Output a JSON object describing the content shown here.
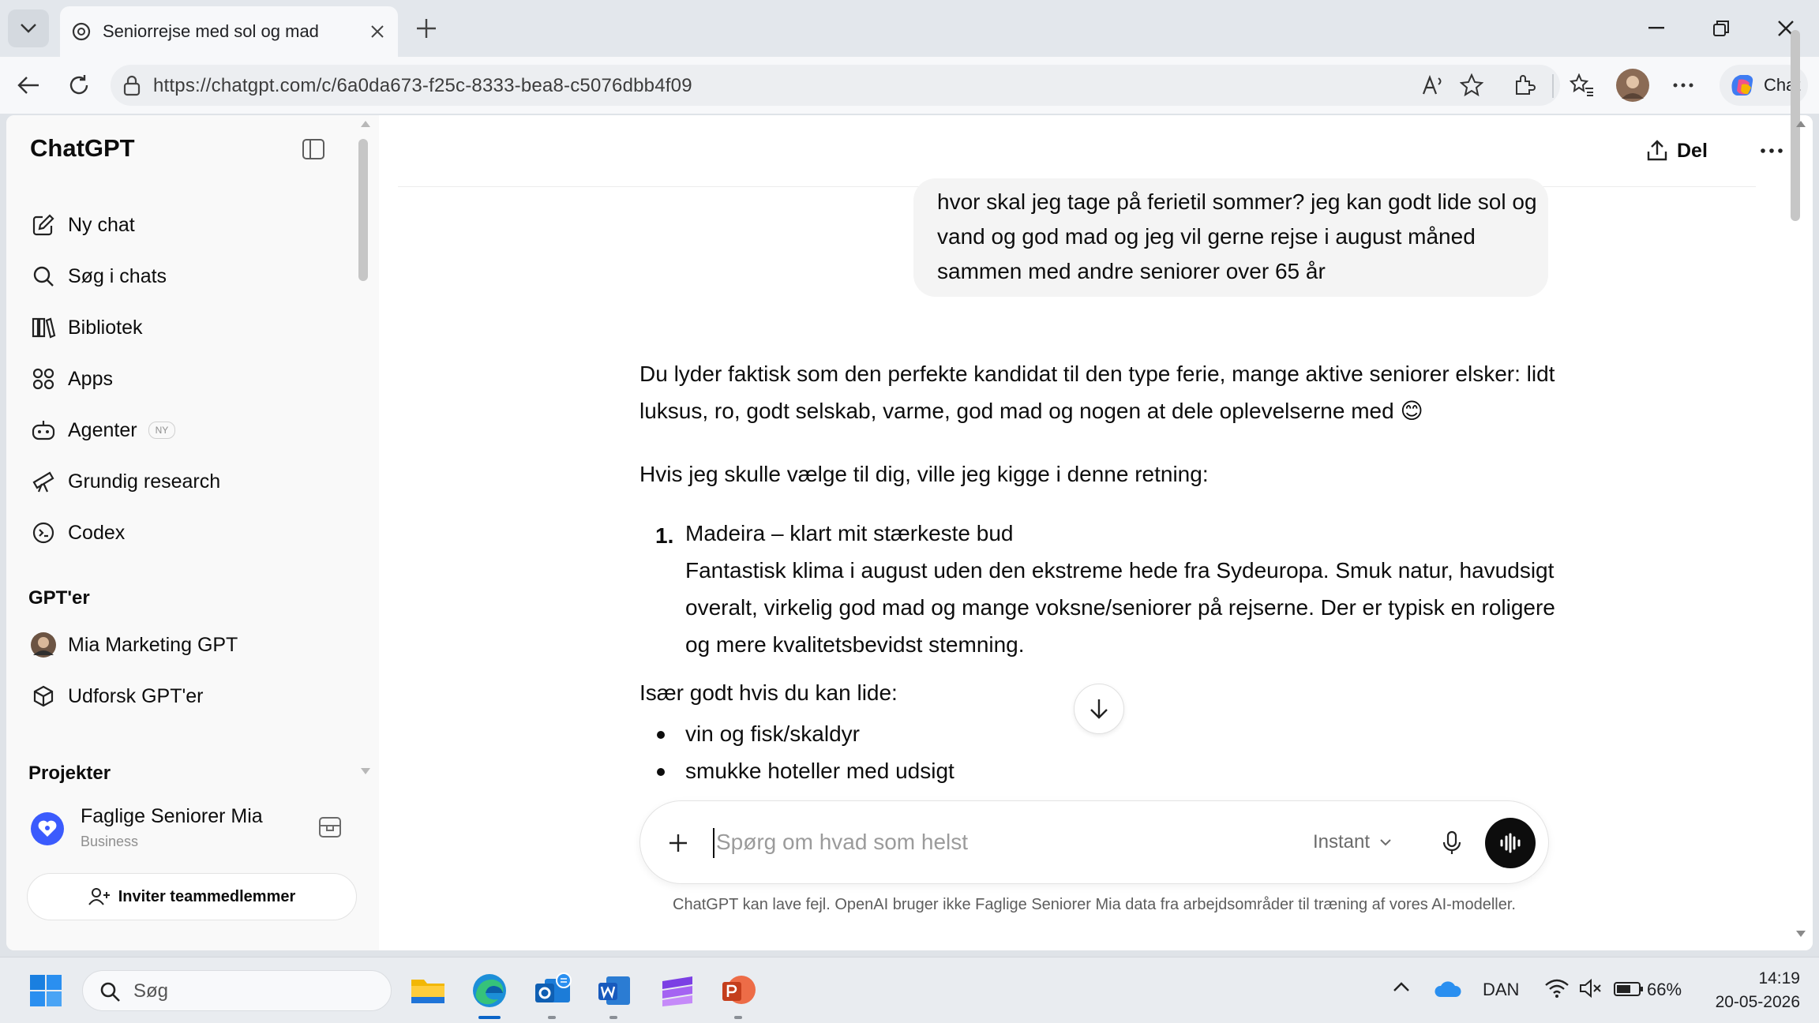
{
  "browser": {
    "tab_title": "Seniorrejse med sol og mad",
    "url": "https://chatgpt.com/c/6a0da673-f25c-8333-bea8-c5076dbb4f09",
    "copilot_label": "Chat"
  },
  "sidebar": {
    "brand": "ChatGPT",
    "nav": [
      {
        "label": "Ny chat",
        "icon": "new-chat-icon"
      },
      {
        "label": "Søg i chats",
        "icon": "search-icon"
      },
      {
        "label": "Bibliotek",
        "icon": "library-icon"
      },
      {
        "label": "Apps",
        "icon": "apps-icon"
      },
      {
        "label": "Agenter",
        "icon": "agent-icon",
        "badge": "NY"
      },
      {
        "label": "Grundig research",
        "icon": "telescope-icon"
      },
      {
        "label": "Codex",
        "icon": "codex-icon"
      }
    ],
    "gpts_heading": "GPT'er",
    "gpts": [
      {
        "label": "Mia Marketing GPT",
        "icon": "gpt-avatar-icon"
      },
      {
        "label": "Udforsk GPT'er",
        "icon": "cube-icon"
      }
    ],
    "projects_heading": "Projekter",
    "project": {
      "name": "Faglige Seniorer Mia",
      "plan": "Business"
    },
    "invite_label": "Inviter teammedlemmer"
  },
  "header": {
    "share_label": "Del"
  },
  "conversation": {
    "user_message": "hvor skal jeg tage på ferietil sommer? jeg kan godt lide sol og vand og god mad og jeg vil gerne rejse i august måned sammen med andre seniorer over 65 år",
    "assistant": {
      "intro": "Du lyder faktisk som den perfekte kandidat til den type ferie, mange aktive seniorer elsker: lidt luksus, ro, godt selskab, varme, god mad og nogen at dele oplevelserne med 😊",
      "lead": "Hvis jeg skulle vælge til dig, ville jeg kigge i denne retning:",
      "item_number": "1.",
      "item_title": "Madeira – klart mit stærkeste bud",
      "item_body": "Fantastisk klima i august uden den ekstreme hede fra Sydeuropa. Smuk natur, havudsigt overalt, virkelig god mad og mange voksne/seniorer på rejserne. Der er typisk en roligere og mere kvalitetsbevidst stemning.",
      "sub_heading": "Især godt hvis du kan lide:",
      "bullets": [
        "vin og fisk/skaldyr",
        "smukke hoteller med udsigt"
      ]
    }
  },
  "composer": {
    "placeholder": "Spørg om hvad som helst",
    "model": "Instant",
    "disclaimer": "ChatGPT kan lave fejl. OpenAI bruger ikke Faglige Seniorer Mia data fra arbejdsområder til træning af vores AI-modeller."
  },
  "taskbar": {
    "search_label": "Søg",
    "language": "DAN",
    "battery": "66%",
    "time": "14:19",
    "date": "20-05-2026"
  },
  "colors": {
    "accent": "#0d0d0d",
    "project_logo": "#3b5bfd",
    "user_bubble": "#f4f4f4"
  }
}
